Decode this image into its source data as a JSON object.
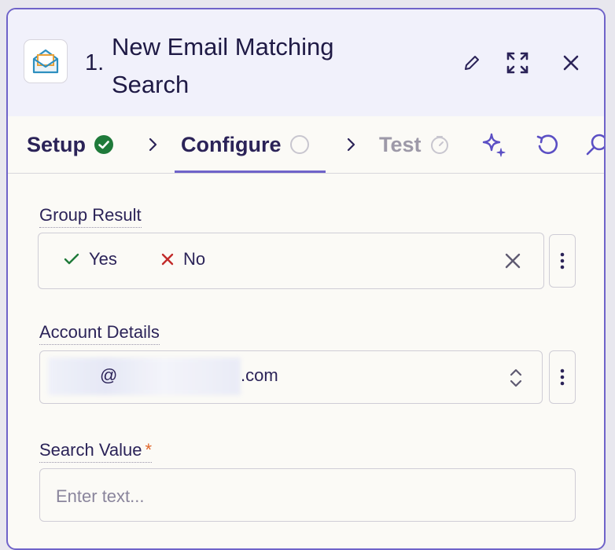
{
  "header": {
    "step_number": "1.",
    "title": "New Email Matching Search",
    "icons": [
      "email-app-icon",
      "pencil-icon",
      "expand-icon",
      "close-icon"
    ]
  },
  "tabs": [
    {
      "label": "Setup",
      "status": "complete",
      "status_icon": "check-circle-icon"
    },
    {
      "label": "Configure",
      "status": "in-progress",
      "status_icon": "empty-circle-icon",
      "active": true
    },
    {
      "label": "Test",
      "status": "pending",
      "status_icon": "timer-icon"
    }
  ],
  "toolbar_icons": [
    "sparkle-icon",
    "undo-icon",
    "search-icon"
  ],
  "fields": {
    "group_result": {
      "label": "Group Result",
      "options": [
        {
          "label": "Yes",
          "icon": "check-icon"
        },
        {
          "label": "No",
          "icon": "x-icon"
        }
      ]
    },
    "account_details": {
      "label": "Account Details",
      "value_at": "@",
      "value_domain": ".com"
    },
    "search_value": {
      "label": "Search Value",
      "required_mark": "*",
      "placeholder": "Enter text..."
    }
  },
  "colors": {
    "accent": "#6f63c9",
    "header_bg": "#f1f1fb",
    "success": "#1f7a3a",
    "danger": "#c22a2a",
    "required": "#e0662a"
  }
}
